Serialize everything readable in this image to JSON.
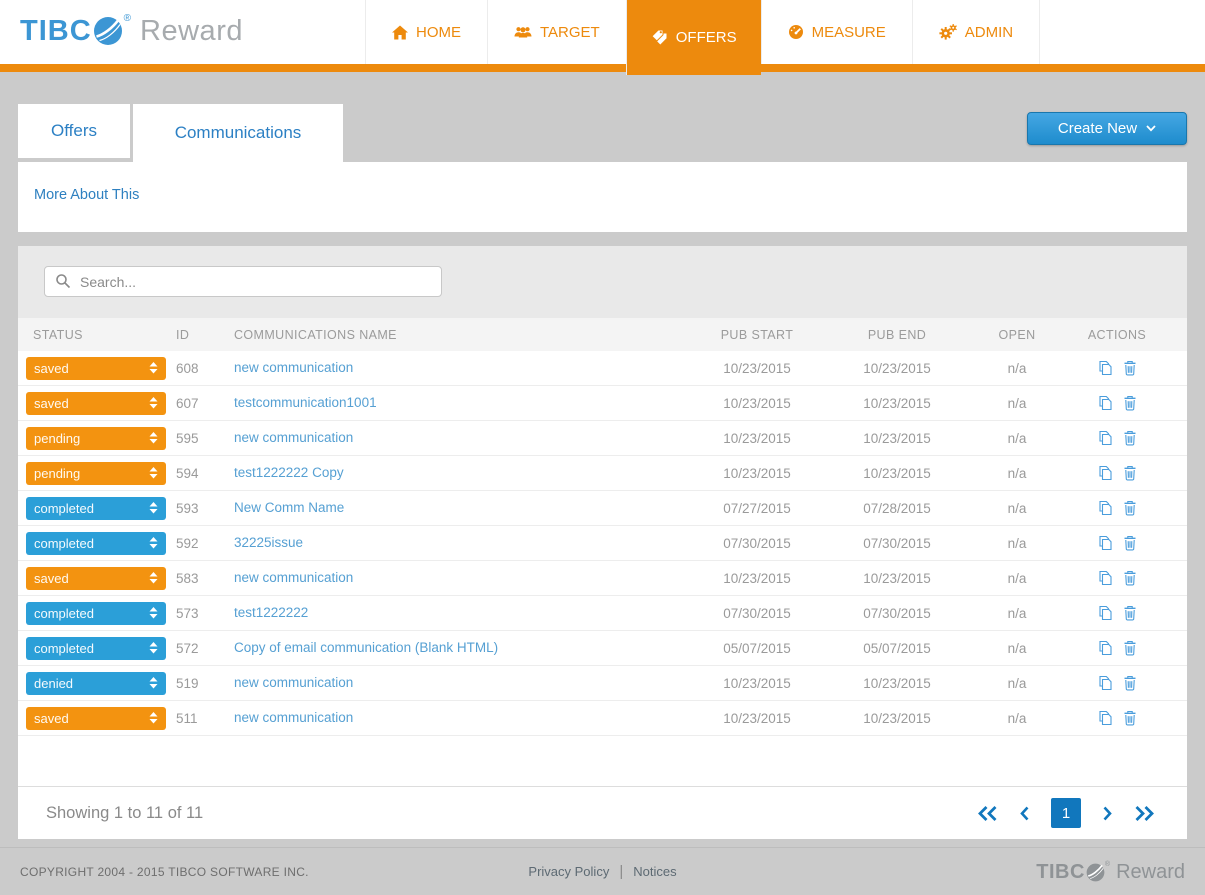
{
  "brand": {
    "text_primary": "TIBC",
    "registered": "®",
    "text_secondary": "Reward"
  },
  "nav": {
    "items": [
      {
        "label": "HOME",
        "icon": "home-icon",
        "active": false
      },
      {
        "label": "TARGET",
        "icon": "users-icon",
        "active": false
      },
      {
        "label": "OFFERS",
        "icon": "tags-icon",
        "active": true
      },
      {
        "label": "MEASURE",
        "icon": "gauge-icon",
        "active": false
      },
      {
        "label": "ADMIN",
        "icon": "gears-icon",
        "active": false
      }
    ]
  },
  "tabs": {
    "offers": "Offers",
    "communications": "Communications"
  },
  "toolbar": {
    "create_new_label": "Create New"
  },
  "links": {
    "more_about": "More About This"
  },
  "search": {
    "placeholder": "Search..."
  },
  "table": {
    "headers": [
      "STATUS",
      "ID",
      "COMMUNICATIONS NAME",
      "PUB START",
      "PUB END",
      "OPEN",
      "ACTIONS"
    ],
    "rows": [
      {
        "status": "saved",
        "status_color": "orange",
        "id": "608",
        "name": "new communication",
        "pub_start": "10/23/2015",
        "pub_end": "10/23/2015",
        "open": "n/a"
      },
      {
        "status": "saved",
        "status_color": "orange",
        "id": "607",
        "name": "testcommunication1001",
        "pub_start": "10/23/2015",
        "pub_end": "10/23/2015",
        "open": "n/a"
      },
      {
        "status": "pending",
        "status_color": "orange",
        "id": "595",
        "name": "new communication",
        "pub_start": "10/23/2015",
        "pub_end": "10/23/2015",
        "open": "n/a"
      },
      {
        "status": "pending",
        "status_color": "orange",
        "id": "594",
        "name": "test1222222 Copy",
        "pub_start": "10/23/2015",
        "pub_end": "10/23/2015",
        "open": "n/a"
      },
      {
        "status": "completed",
        "status_color": "blue",
        "id": "593",
        "name": "New Comm Name",
        "pub_start": "07/27/2015",
        "pub_end": "07/28/2015",
        "open": "n/a"
      },
      {
        "status": "completed",
        "status_color": "blue",
        "id": "592",
        "name": "32225issue",
        "pub_start": "07/30/2015",
        "pub_end": "07/30/2015",
        "open": "n/a"
      },
      {
        "status": "saved",
        "status_color": "orange",
        "id": "583",
        "name": "new communication",
        "pub_start": "10/23/2015",
        "pub_end": "10/23/2015",
        "open": "n/a"
      },
      {
        "status": "completed",
        "status_color": "blue",
        "id": "573",
        "name": "test1222222",
        "pub_start": "07/30/2015",
        "pub_end": "07/30/2015",
        "open": "n/a"
      },
      {
        "status": "completed",
        "status_color": "blue",
        "id": "572",
        "name": "Copy of email communication (Blank HTML)",
        "pub_start": "05/07/2015",
        "pub_end": "05/07/2015",
        "open": "n/a"
      },
      {
        "status": "denied",
        "status_color": "blue",
        "id": "519",
        "name": "new communication",
        "pub_start": "10/23/2015",
        "pub_end": "10/23/2015",
        "open": "n/a"
      },
      {
        "status": "saved",
        "status_color": "orange",
        "id": "511",
        "name": "new communication",
        "pub_start": "10/23/2015",
        "pub_end": "10/23/2015",
        "open": "n/a"
      }
    ]
  },
  "pagination": {
    "summary": "Showing 1 to 11 of 11",
    "current_page": "1"
  },
  "footer": {
    "copyright": "COPYRIGHT 2004 - 2015 TIBCO SOFTWARE INC.",
    "privacy_policy": "Privacy Policy",
    "notices": "Notices",
    "brand_primary": "TIBC",
    "brand_registered": "®",
    "brand_secondary": "Reward"
  },
  "colors": {
    "accent_orange": "#ED8A0D",
    "select_orange": "#F39310",
    "select_blue": "#2B9FD8",
    "link_blue": "#56A0D3",
    "tab_blue": "#2C80C4",
    "pagination_blue": "#1177BD",
    "button_blue_top": "#45A7E3",
    "button_blue_bottom": "#1E8CCD"
  }
}
